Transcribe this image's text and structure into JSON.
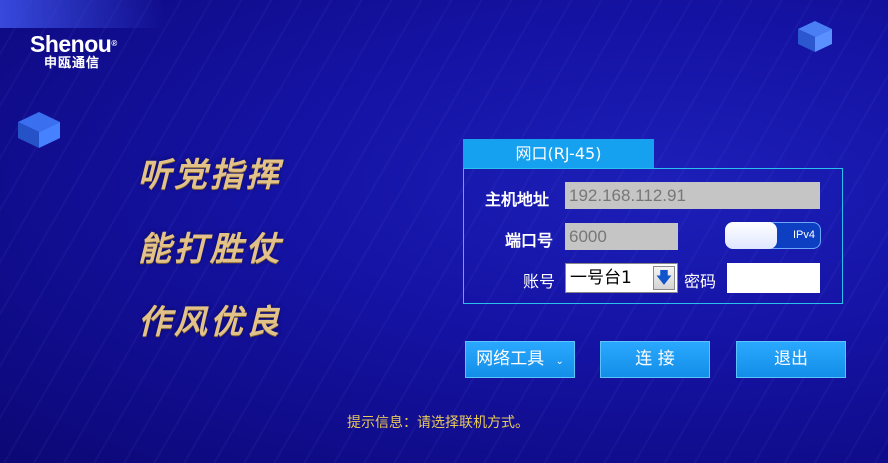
{
  "brand": {
    "name": "Shenou",
    "reg_mark": "®",
    "cn_name": "申瓯通信"
  },
  "slogans": [
    "听党指挥",
    "能打胜仗",
    "作风优良"
  ],
  "connection": {
    "tab_label": "网口(RJ-45)",
    "host_label": "主机地址",
    "host_value": "192.168.112.91",
    "port_label": "端口号",
    "port_value": "6000",
    "ip_mode": "IPv4",
    "account_label": "账号",
    "account_value": "一号台1",
    "password_label": "密码",
    "password_value": ""
  },
  "buttons": {
    "network_tools": "网络工具",
    "connect": "连 接",
    "exit": "退出"
  },
  "hint": "提示信息：请选择联机方式。",
  "colors": {
    "slogan": "#e2c289",
    "tab": "#16a0f0",
    "hint": "#e9c95a",
    "border": "#29c0f0"
  }
}
